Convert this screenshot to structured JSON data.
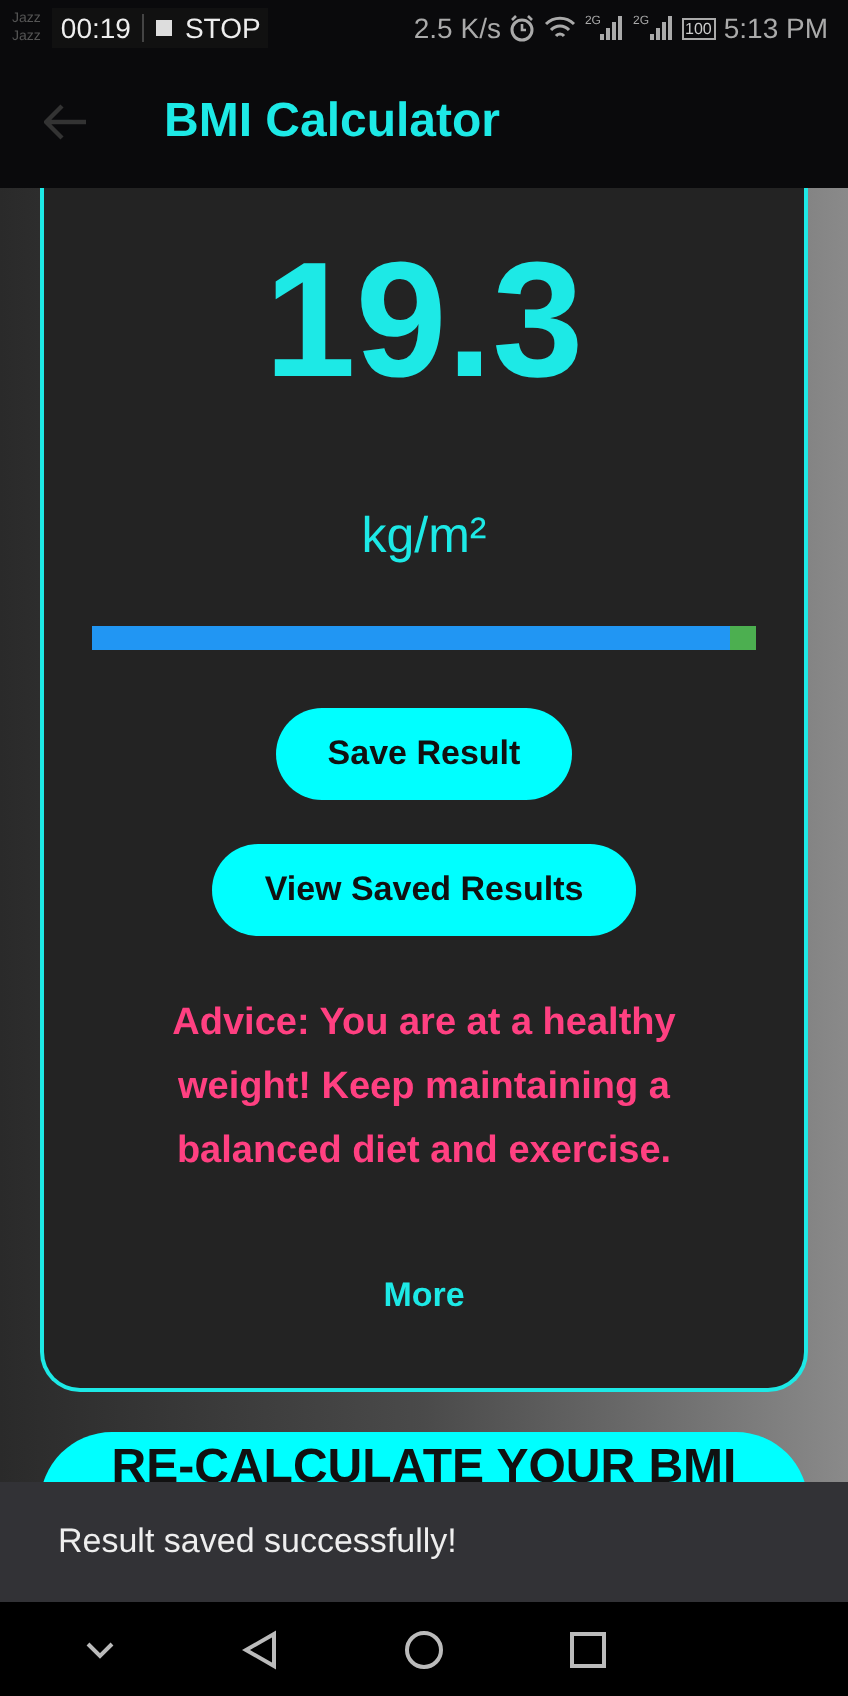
{
  "status_bar": {
    "carrier_labels": [
      "Jazz",
      "Jazz"
    ],
    "recording_time": "00:19",
    "stop_label": "STOP",
    "net_speed": "2.5 K/s",
    "network_types": [
      "2G",
      "2G"
    ],
    "battery": "100",
    "clock": "5:13 PM"
  },
  "app_bar": {
    "title": "BMI Calculator"
  },
  "result": {
    "value": "19.3",
    "unit": "kg/m²",
    "level": 0.96,
    "buttons": [
      "Save Result",
      "View Saved Results"
    ],
    "advice": "Advice: You are at a healthy weight! Keep maintaining a balanced diet and exercise.",
    "more": "More"
  },
  "recalculate_button": "RE-CALCULATE YOUR BMI",
  "snackbar": {
    "message": "Result saved successfully!"
  }
}
